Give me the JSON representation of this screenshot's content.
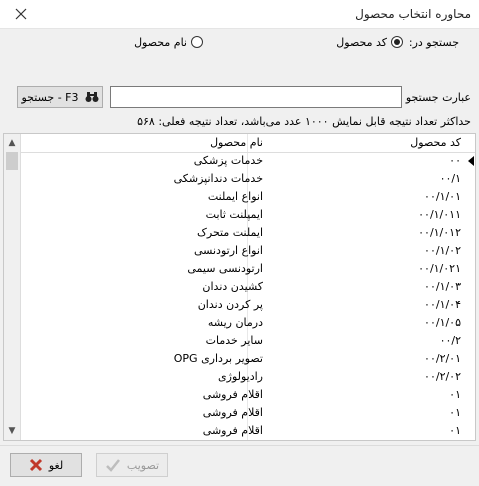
{
  "window": {
    "title": "محاوره انتخاب محصول"
  },
  "search_in": {
    "label": "جستجو در:",
    "options": [
      {
        "label": "کد محصول",
        "selected": true
      },
      {
        "label": "نام محصول",
        "selected": false
      }
    ]
  },
  "search": {
    "label": "عبارت جستجو",
    "value": "",
    "button_label": "جستجو - F3"
  },
  "info_text": "حداکثر تعداد نتیجه قابل نمایش ۱۰۰۰ عدد می‌باشد، تعداد نتیجه فعلی: ۵۶۸",
  "table": {
    "columns": [
      "کد محصول",
      "نام محصول"
    ],
    "rows": [
      {
        "code": "۰۰",
        "name": "خدمات پزشکی"
      },
      {
        "code": "۰۰/۱",
        "name": "خدمات دندانپزشکی"
      },
      {
        "code": "۰۰/۱/۰۱",
        "name": "انواع ایملنت"
      },
      {
        "code": "۰۰/۱/۰۱۱",
        "name": "ایمپلنت ثابت"
      },
      {
        "code": "۰۰/۱/۰۱۲",
        "name": "ایملنت متحرک"
      },
      {
        "code": "۰۰/۱/۰۲",
        "name": "انواع ارتودنسی"
      },
      {
        "code": "۰۰/۱/۰۲۱",
        "name": "ارتودنسی سیمی"
      },
      {
        "code": "۰۰/۱/۰۳",
        "name": "کشیدن دندان"
      },
      {
        "code": "۰۰/۱/۰۴",
        "name": "پر کردن دندان"
      },
      {
        "code": "۰۰/۱/۰۵",
        "name": "درمان ریشه"
      },
      {
        "code": "۰۰/۲",
        "name": "سایر خدمات"
      },
      {
        "code": "۰۰/۲/۰۱",
        "name": "تصویر برداری OPG"
      },
      {
        "code": "۰۰/۲/۰۲",
        "name": "رادیولوژی"
      },
      {
        "code": "۰۱",
        "name": "اقلام فروشی"
      },
      {
        "code": "۰۱",
        "name": "اقلام فروشی"
      },
      {
        "code": "۰۱",
        "name": "اقلام فروشی"
      }
    ]
  },
  "footer": {
    "cancel_label": "لغو",
    "approve_label": "تصویب"
  },
  "colors": {
    "cancel_icon": "#c0392b",
    "approve_icon_disabled": "#bdbdbd"
  }
}
